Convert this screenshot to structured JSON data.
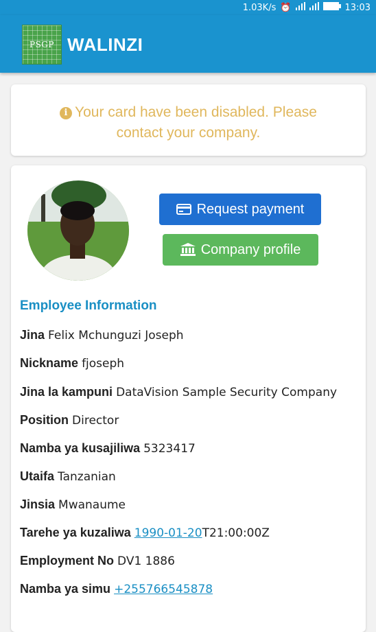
{
  "status_bar": {
    "network_speed": "1.03K/s",
    "time": "13:03"
  },
  "app": {
    "logo_text": "PSGP",
    "title": "WALINZI"
  },
  "alert": {
    "message": "Your card have been disabled. Please contact your company.",
    "color": "#e0b75c"
  },
  "actions": {
    "request_payment": "Request payment",
    "company_profile": "Company profile"
  },
  "employee": {
    "section_title": "Employee Information",
    "name_label": "Jina",
    "name": "Felix Mchunguzi Joseph",
    "nickname_label": "Nickname",
    "nickname": "fjoseph",
    "company_label": "Jina la kampuni",
    "company": "DataVision Sample Security Company",
    "position_label": "Position",
    "position": "Director",
    "reg_label": "Namba ya kusajiliwa",
    "reg_no": "5323417",
    "nationality_label": "Utaifa",
    "nationality": "Tanzanian",
    "gender_label": "Jinsia",
    "gender": "Mwanaume",
    "dob_label": "Tarehe ya kuzaliwa",
    "dob_date": "1990-01-20",
    "dob_time": "T21:00:00Z",
    "employment_label": "Employment No",
    "employment_no": "DV1 1886",
    "phone_label": "Namba ya simu",
    "phone": "+255766545878"
  },
  "colors": {
    "appbar": "#1a93cf",
    "primary": "#1f6fd1",
    "success": "#5cb85c",
    "link": "#1a8fc4"
  }
}
